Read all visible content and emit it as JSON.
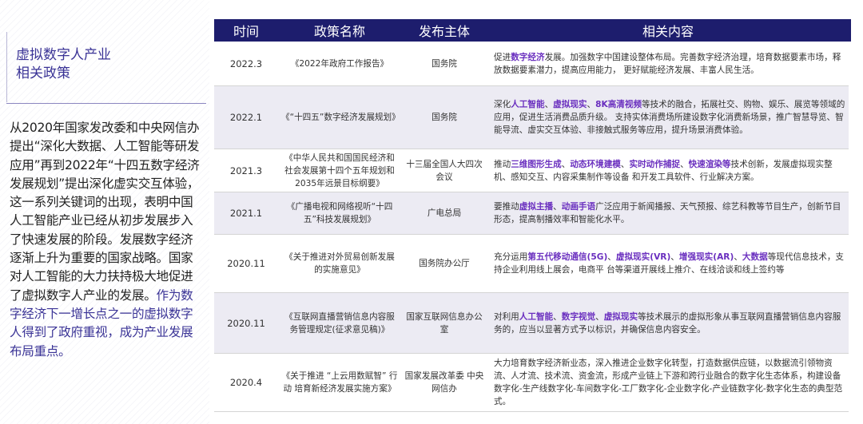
{
  "sidebar": {
    "title_line1": "虚拟数字人产业",
    "title_line2": "相关政策",
    "intro_text": "从2020年国家发改委和中央网信办提出“深化大数据、人工智能等研发应用”再到2022年“十四五数字经济发展规划”提出深化虚实交互体验，这一系列关键词的出现，表明中国人工智能产业已经从初步发展步入了快速发展的阶段。发展数字经济逐渐上升为重要的国家战略。国家对人工智能的大力扶持极大地促进了虚拟数字人产业的发展。",
    "intro_highlight": "作为数字经济下一增长点之一的虚拟数字人得到了政府重视，成为产业发展布局重点。"
  },
  "table": {
    "headers": [
      "时间",
      "政策名称",
      "发布主体",
      "相关内容"
    ],
    "rows": [
      {
        "time": "2022.3",
        "name": "《2022年政府工作报告》",
        "issuer": "国务院",
        "content": [
          [
            "促进",
            0
          ],
          [
            "数字经济",
            1
          ],
          [
            "发展。加强数字中国建设整体布局。完善数字经济治理，培育数据要素市场，释放数据要素潜力，提高应用能力， 更好赋能经济发展、丰富人民生活。",
            0
          ]
        ]
      },
      {
        "time": "2022.1",
        "name": "《“十四五”数字经济发展规划》",
        "issuer": "国务院",
        "content": [
          [
            "深化",
            0
          ],
          [
            "人工智能",
            1
          ],
          [
            "、",
            0
          ],
          [
            "虚拟现实",
            1
          ],
          [
            "、",
            0
          ],
          [
            "8K高清视频",
            1
          ],
          [
            "等技术的融合，拓展社交、购物、娱乐、展览等领域的应用，促进生活消费品质升级。 支持实体消费场所建设数字化消费新场景，推广智慧导览、智能导流、虚实交互体验、非接触式服务等应用，提升场景消费体验。",
            0
          ]
        ]
      },
      {
        "time": "2021.3",
        "name": "《中华人民共和国国民经济和社会发展第十四个五年规划和2035年远景目标纲要》",
        "issuer": "十三届全国人大四次会议",
        "content": [
          [
            "推动",
            0
          ],
          [
            "三维图形生成",
            1
          ],
          [
            "、",
            0
          ],
          [
            "动态环境建模",
            1
          ],
          [
            "、",
            0
          ],
          [
            "实时动作捕捉",
            1
          ],
          [
            "、",
            0
          ],
          [
            "快速渲染等",
            1
          ],
          [
            "技术创新，发展虚拟现实整机、感知交互、内容采集制作等设备 和开发工具软件、行业解决方案。",
            0
          ]
        ]
      },
      {
        "time": "2021.1",
        "name": "《广播电视和网络视听“十四五”科技发展规划》",
        "issuer": "广电总局",
        "content": [
          [
            "要推动",
            0
          ],
          [
            "虚拟主播",
            1
          ],
          [
            "、",
            0
          ],
          [
            "动画手语",
            1
          ],
          [
            "广泛应用于新闻播报、天气预报、综艺科教等节目生产，创新节目形态，提高制播效率和智能化水平。",
            0
          ]
        ]
      },
      {
        "time": "2020.11",
        "name": "《关于推进对外贸易创新发展的实施意见》",
        "issuer": "国务院办公厅",
        "content": [
          [
            "充分运用",
            0
          ],
          [
            "第五代移动通信(5G)",
            1
          ],
          [
            "、",
            0
          ],
          [
            "虚拟现实(VR)",
            1
          ],
          [
            "、",
            0
          ],
          [
            "增强现实(AR)",
            1
          ],
          [
            "、",
            0
          ],
          [
            "大数据",
            1
          ],
          [
            "等现代信息技术，支持企业利用线上展会，电商平 台等渠道开展线上推介、在线洽谈和线上签约等",
            0
          ]
        ]
      },
      {
        "time": "2020.11",
        "name": "《互联网直播营销信息内容服务管理规定(征求意见稿)》",
        "issuer": "国家互联网信息办公室",
        "content": [
          [
            "对利用",
            0
          ],
          [
            "人工智能",
            1
          ],
          [
            "、",
            0
          ],
          [
            "数字视觉",
            1
          ],
          [
            "、",
            0
          ],
          [
            "虚拟现实",
            1
          ],
          [
            "等技术展示的虚拟形象从事互联网直播营销信息内容服务的，应当以显著方式予以标识，并确保信息内容安全。",
            0
          ]
        ]
      },
      {
        "time": "2020.4",
        "name": "《关于推进 “上云用数赋智” 行动 培育新经济发展实施方案》",
        "issuer": "国家发展改革委 中央网信办",
        "content": [
          [
            "大力培育数字经济新业态，深入推进企业数字化转型，打造数据供应链，以数据流引领物资流、人才流、技术流、资金流，形成产业链上下游和跨行业融合的数字化生态体系，构建设备数字化-生产线数字化-车间数字化-工厂数字化-企业数字化-产业链数字化-数字化生态的典型范式。",
            0
          ]
        ]
      }
    ]
  },
  "colors": {
    "header_bg": "#1d1d6d",
    "keyword": "#6a2fbf",
    "title": "#3a3396",
    "alt_row": "#ecebf3"
  }
}
